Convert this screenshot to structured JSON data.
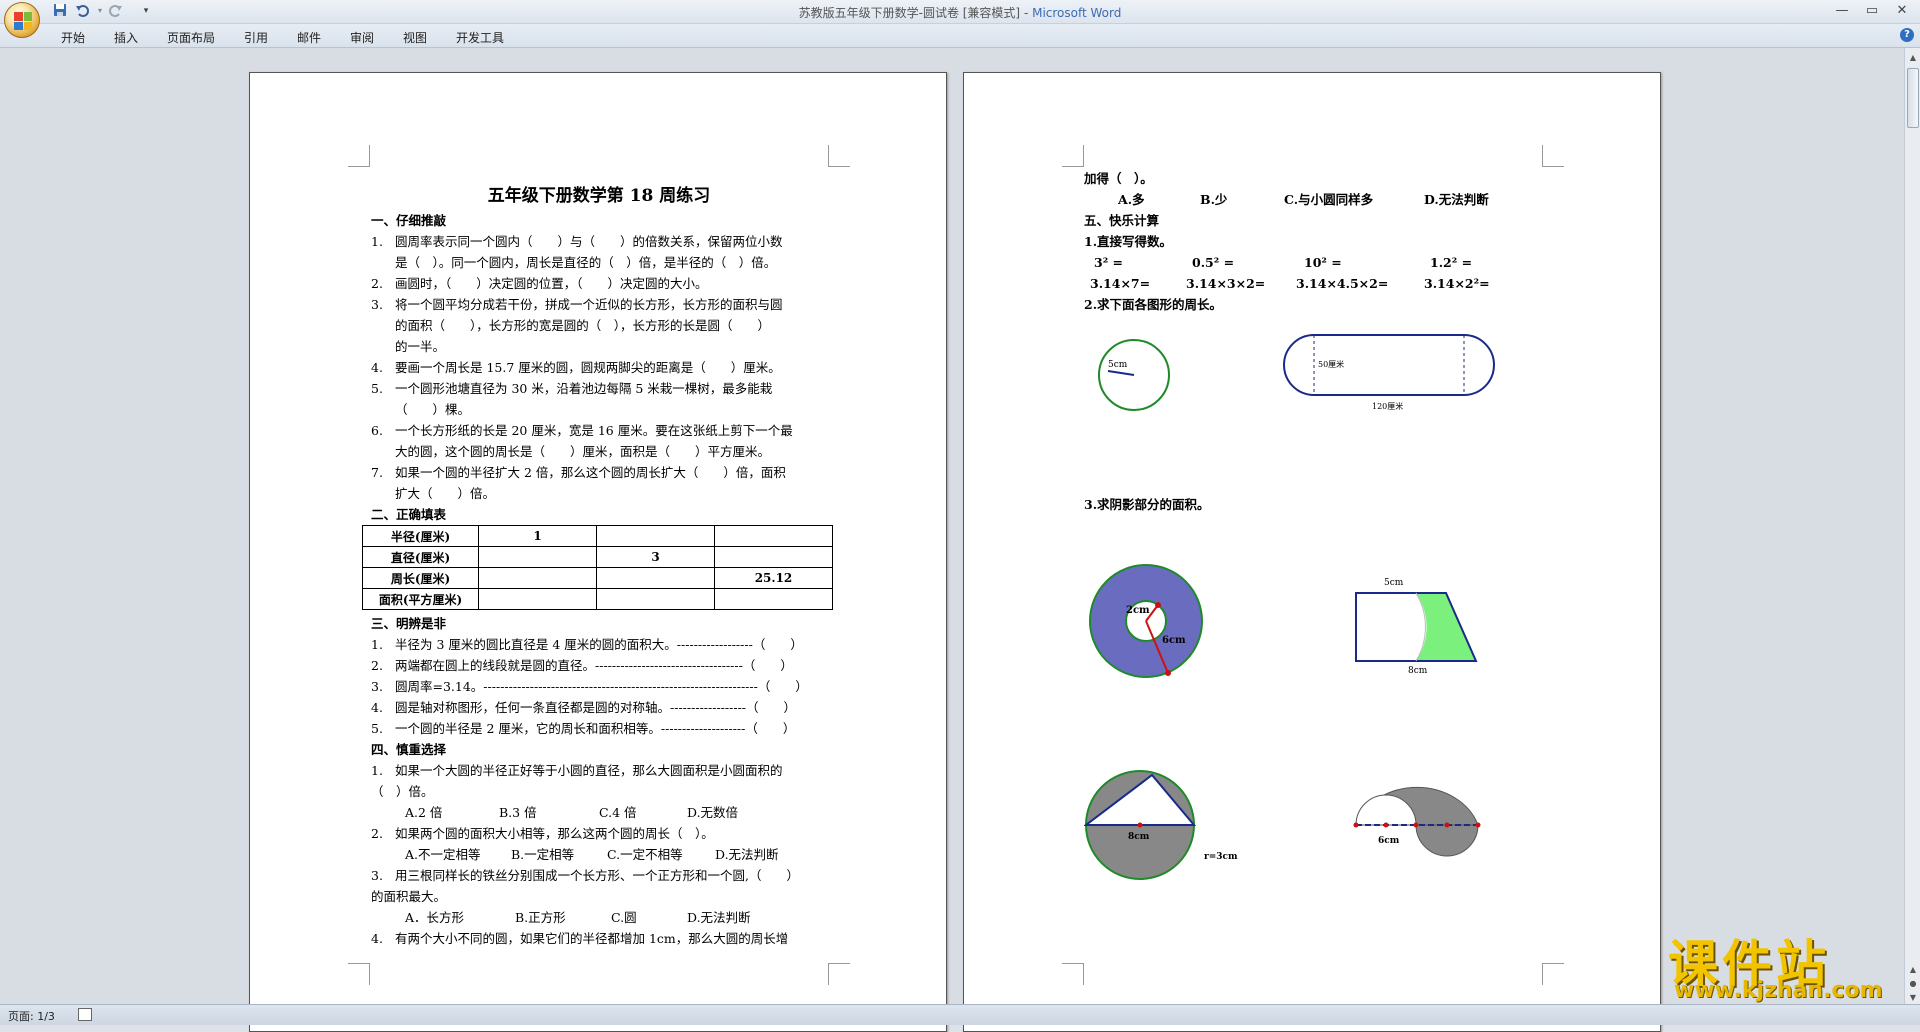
{
  "window": {
    "doc_title": "苏教版五年级下册数学-圆试卷 [兼容模式]",
    "separator": " - ",
    "app_name": "Microsoft Word"
  },
  "quick_access": {
    "save_icon": "save-icon",
    "undo_icon": "undo-icon",
    "redo_icon": "redo-icon",
    "customize_glyph": "▾"
  },
  "ribbon_tabs": [
    "开始",
    "插入",
    "页面布局",
    "引用",
    "邮件",
    "审阅",
    "视图",
    "开发工具"
  ],
  "page1": {
    "title": "五年级下册数学第 18 周练习",
    "s1_title": "一、仔细推敲",
    "q1_1a": "圆周率表示同一个圆内（　　）与（　　）的倍数关系，保留两位小数",
    "q1_1b": "是（　）。同一个圆内，周长是直径的（　）倍，是半径的（　）倍。",
    "q1_2": "画圆时，（　　）决定圆的位置，（　　）决定圆的大小。",
    "q1_3a": "将一个圆平均分成若干份，拼成一个近似的长方形，长方形的面积与圆",
    "q1_3b": "的面积（　　），长方形的宽是圆的（　），长方形的长是圆（　　）",
    "q1_3c": "的一半。",
    "q1_4": "要画一个周长是 15.7 厘米的圆，圆规两脚尖的距离是（　　）厘米。",
    "q1_5a": "一个圆形池塘直径为 30 米，沿着池边每隔 5 米栽一棵树，最多能栽",
    "q1_5b": "（　　）棵。",
    "q1_6a": "一个长方形纸的长是 20 厘米，宽是 16 厘米。要在这张纸上剪下一个最",
    "q1_6b": "大的圆，这个圆的周长是（　　）厘米，面积是（　　）平方厘米。",
    "q1_7a": "如果一个圆的半径扩大 2 倍，那么这个圆的周长扩大（　　）倍，面积",
    "q1_7b": "扩大（　　）倍。",
    "s2_title": "二、正确填表",
    "table": {
      "rows": [
        [
          "半径(厘米)",
          "1",
          "",
          ""
        ],
        [
          "直径(厘米)",
          "",
          "3",
          ""
        ],
        [
          "周长(厘米)",
          "",
          "",
          "25.12"
        ],
        [
          "面积(平方厘米)",
          "",
          "",
          ""
        ]
      ]
    },
    "s3_title": "三、明辨是非",
    "q3_1": "半径为 3 厘米的圆比直径是 4 厘米的圆的面积大。------------------（　　）",
    "q3_2": "两端都在圆上的线段就是圆的直径。-----------------------------------（　　）",
    "q3_3": "圆周率=3.14。-----------------------------------------------------------------（　　）",
    "q3_4": "圆是轴对称图形，任何一条直径都是圆的对称轴。------------------（　　）",
    "q3_5": "一个圆的半径是 2 厘米，它的周长和面积相等。--------------------（　　）",
    "s4_title": "四、慎重选择",
    "q4_1a": "如果一个大圆的半径正好等于小圆的直径，那么大圆面积是小圆面积的",
    "q4_1b": "（　）倍。",
    "q4_1_opts": [
      "A.2 倍",
      "B.3 倍",
      "C.4 倍",
      "D.无数倍"
    ],
    "q4_2": "如果两个圆的面积大小相等，那么这两个圆的周长（　）。",
    "q4_2_opts": [
      "A.不一定相等",
      "B.一定相等",
      "C.一定不相等",
      "D.无法判断"
    ],
    "q4_3a": "用三根同样长的铁丝分别围成一个长方形、一个正方形和一个圆,（　　）",
    "q4_3b": "的面积最大。",
    "q4_3_opts": [
      "A．长方形",
      "B.正方形",
      "C.圆",
      "D.无法判断"
    ],
    "q4_4": "有两个大小不同的圆，如果它们的半径都增加 1cm，那么大圆的周长增"
  },
  "page2": {
    "cont": "加得（　）。",
    "cont_opts": [
      "A.多",
      "B.少",
      "C.与小圆同样多",
      "D.无法判断"
    ],
    "s5_title": "五、快乐计算",
    "p1_title": "1.直接写得数。",
    "calc_row1": [
      "3² =",
      "0.5² =",
      "10² =",
      "1.2² ="
    ],
    "calc_row2": [
      "3.14×7=",
      "3.14×3×2=",
      "3.14×4.5×2=",
      "3.14×2²="
    ],
    "p2_title": "2.求下面各图形的周长。",
    "fig_circle_label": "5cm",
    "fig_track_height": "50厘米",
    "fig_track_length": "120厘米",
    "p3_title": "3.求阴影部分的面积。",
    "fig_ring_inner": "2cm",
    "fig_ring_outer": "6cm",
    "fig_trap_top": "5cm",
    "fig_trap_bottom": "8cm",
    "fig_tri_label": "8cm",
    "fig_tri_r": "r=3cm",
    "fig_semi_label": "6cm"
  },
  "status": {
    "page_info": "页面: 1/3"
  },
  "watermark": {
    "text": "课件站",
    "url": "www.kjzhan.com"
  },
  "colors": {
    "ring_fill": "#6a6cc0",
    "circle_stroke": "#1f8a2a",
    "shade_green": "#7cf07c",
    "gray_shade": "#888888",
    "track_blue": "#1a2a8a",
    "red_dot": "#cc1111",
    "word_blue": "#3b6bb2"
  }
}
